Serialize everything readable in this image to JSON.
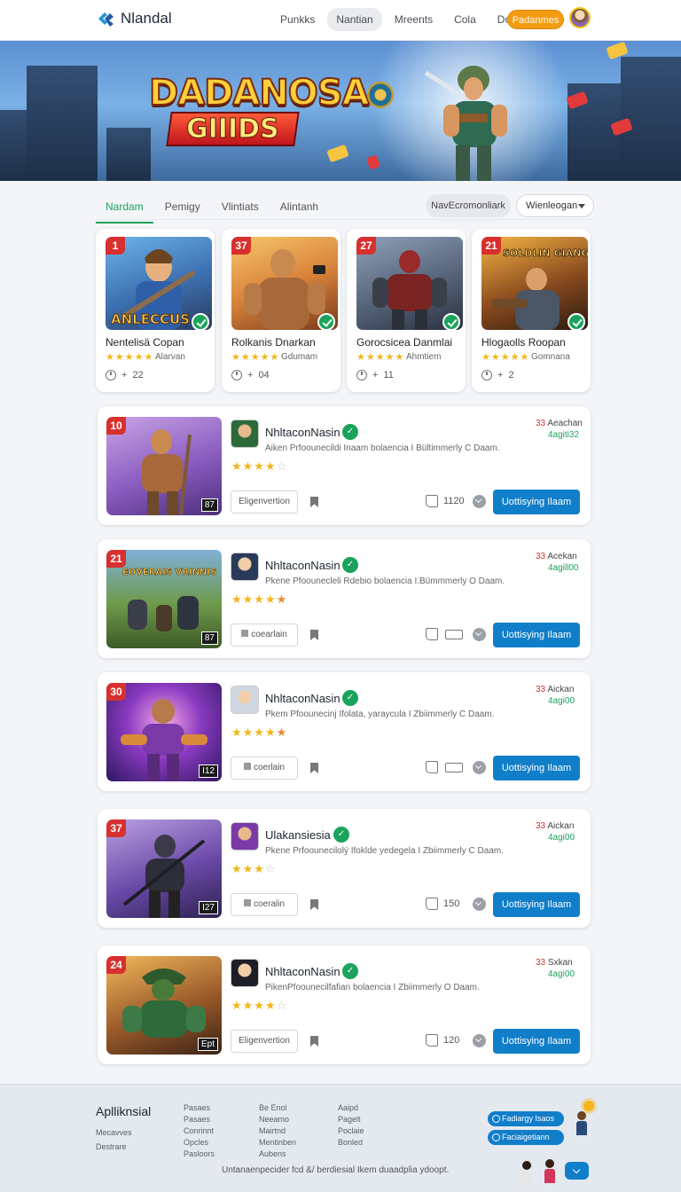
{
  "brand": {
    "name": "Nlandal"
  },
  "nav": {
    "links": [
      "Punkks",
      "Nantian",
      "Mreents",
      "Cola",
      "Donises"
    ],
    "active_index": 1,
    "cta": "Padanmes"
  },
  "hero": {
    "title_line1": "DADANOSA",
    "title_line2": "GIIIDS"
  },
  "tabs": {
    "items": [
      "Nardam",
      "Pemigy",
      "Vlintiats",
      "Alintanh"
    ],
    "active_index": 0
  },
  "filters": {
    "pill": "NavEcromonliark",
    "dropdown": "Wienleogan"
  },
  "featured": [
    {
      "rank": "1",
      "title": "Nentelisä Copan",
      "stars": "★★★★★",
      "sub": "Alarvan",
      "meta": "22",
      "meta_prefix": "+"
    },
    {
      "rank": "37",
      "title": "Rolkanis Dnarkan",
      "stars": "★★★★★",
      "sub": "Gdumam",
      "meta": "04",
      "meta_prefix": "+"
    },
    {
      "rank": "27",
      "title": "Gorocsicea Danmlai",
      "stars": "★★★★★",
      "sub": "Ahmtiem",
      "meta": "11",
      "meta_prefix": "+"
    },
    {
      "rank": "21",
      "title": "Hlogaolls Roopan",
      "stars": "★★★★★",
      "sub": "Gomnana",
      "meta": "2",
      "meta_prefix": "+"
    }
  ],
  "featured_tags": [
    "ANLECCUS",
    "SOLDLIN GIANGE"
  ],
  "list": [
    {
      "rank": "10",
      "name": "NhltaconNasin",
      "desc": "Aiken Prfoounecildi Inaam bolaencia I Bültimmerly C Daam.",
      "stars": "★★★★",
      "half": "☆",
      "btn": "Eligenvertion",
      "likes": "1120",
      "cta": "Uottisying Ilaam",
      "rank_num": "33",
      "rank_label": "Aeachan",
      "sub": "4agiti32",
      "tag": "87"
    },
    {
      "rank": "21",
      "name": "NhltaconNasin",
      "desc": "Pkene Pfoounecleli Rdebio bolaencia I.Bümmmerly O Daam.",
      "stars": "★★★★",
      "half": "★",
      "btn": "coearlain",
      "likes": "",
      "cta": "Uottisying Ilaam",
      "rank_num": "33",
      "rank_label": "Acekan",
      "sub": "4agill00",
      "tag": "87",
      "img_text": "EOVERAIS VRINNIS"
    },
    {
      "rank": "30",
      "name": "NhltaconNasin",
      "desc": "Pkem Pfoounecinj Ifolata, yaraycula I Zbiimmerly C Daam.",
      "stars": "★★★★",
      "half": "★",
      "btn": "coerlain",
      "likes": "",
      "cta": "Uottisying Ilaam",
      "rank_num": "33",
      "rank_label": "Aickan",
      "sub": "4agi00",
      "tag": "I12"
    },
    {
      "rank": "37",
      "name": "Ulakansiesia",
      "desc": "Pkene Prfoounecilolý Ifoklde yedegela I Zbiimmerly C Daam.",
      "stars": "★★★",
      "half": "☆",
      "btn": "coeralin",
      "likes": "150",
      "cta": "Uottisying Ilaam",
      "rank_num": "33",
      "rank_label": "Aickan",
      "sub": "4agi00",
      "tag": "I27"
    },
    {
      "rank": "24",
      "name": "NhltaconNasin",
      "desc": "PikenPfoounecilfafian bolaencia I Zbiimmerly O Daam.",
      "stars": "★★★★",
      "half": "☆",
      "btn": "Eligenvertion",
      "likes": "120",
      "cta": "Uottisying Ilaam",
      "rank_num": "33",
      "rank_label": "Sxkan",
      "sub": "4agi00",
      "tag": "Ept"
    }
  ],
  "footer": {
    "brand": "Aplliknsial",
    "brand_links": [
      "Mecavves",
      "Destrare"
    ],
    "col1": [
      "Pasaes",
      "Pasaes",
      "Conrinnt",
      "Opcles",
      "Pasloors"
    ],
    "col2": [
      "Be Enol",
      "Neeamo",
      "Mairtnd",
      "Mentinben",
      "Aubens"
    ],
    "col3": [
      "Aaipd",
      "Pagelt",
      "Poclaie",
      "Bonled"
    ],
    "buttons": [
      "Fadiargy Isaos",
      "Faciaigetiann"
    ],
    "bottom": "Untanaenpecider fcd &/ berdiesial Ikem duaadplia ydoopt."
  },
  "colors": {
    "accent_green": "#1aa35c",
    "primary_blue": "#117ec9",
    "cta_orange": "#f39c12",
    "rank_red": "#d8302e"
  }
}
